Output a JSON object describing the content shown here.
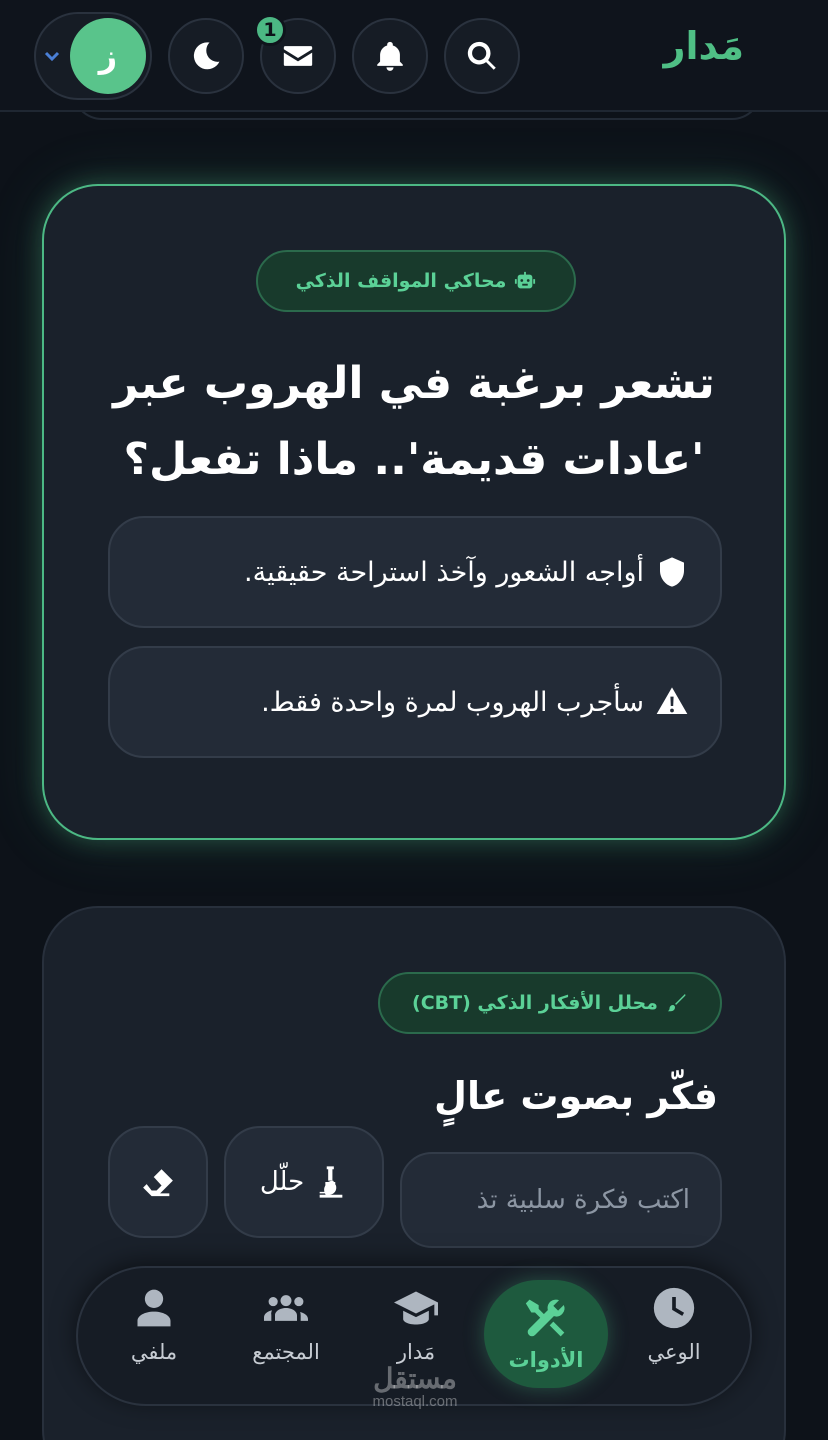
{
  "header": {
    "brand": "مَدار",
    "notification_count": "1",
    "avatar_initial": "ز",
    "icons": [
      "search-icon",
      "bell-icon",
      "envelope-icon",
      "moon-icon",
      "chevron-down-icon"
    ]
  },
  "simulator": {
    "badge": "محاكي المواقف الذكي",
    "question": "تشعر برغبة في الهروب عبر 'عادات قديمة'.. ماذا تفعل؟",
    "options": [
      {
        "label": "أواجه الشعور وآخذ استراحة حقيقية.",
        "icon": "shield-icon"
      },
      {
        "label": "سأجرب الهروب لمرة واحدة فقط.",
        "icon": "warning-icon"
      }
    ]
  },
  "thought_analyzer": {
    "badge": "محلل الأفكار الذكي (CBT)",
    "title": "فكّر بصوت عالٍ",
    "input_placeholder": "اكتب فكرة سلبية تذ",
    "analyze_label": "حلّل"
  },
  "bottom_nav": {
    "items": [
      {
        "label": "الوعي",
        "icon": "clock-icon"
      },
      {
        "label": "الأدوات",
        "icon": "tools-icon",
        "active": true
      },
      {
        "label": "مَدار",
        "icon": "graduation-cap-icon"
      },
      {
        "label": "المجتمع",
        "icon": "users-icon"
      },
      {
        "label": "ملفي",
        "icon": "user-icon"
      }
    ]
  },
  "watermark": {
    "main": "مستقل",
    "sub": "mostaql.com"
  },
  "colors": {
    "accent": "#4cb884",
    "background": "#0d1219",
    "card": "#1a212b",
    "avatar": "#59c48b",
    "chevron": "#4a7fd6"
  }
}
